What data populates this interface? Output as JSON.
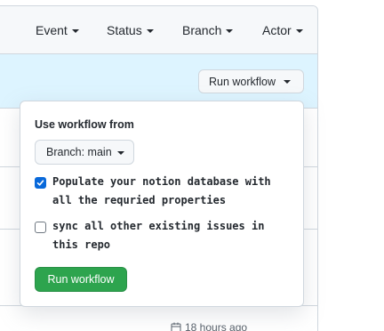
{
  "filters": [
    {
      "label": "Event"
    },
    {
      "label": "Status"
    },
    {
      "label": "Branch"
    },
    {
      "label": "Actor"
    }
  ],
  "run_button_label": "Run workflow",
  "popover": {
    "title": "Use workflow from",
    "branch_label": "Branch: main",
    "inputs": [
      {
        "label": "Populate your notion database with all the requried properties",
        "checked": true
      },
      {
        "label": "sync all other existing issues in this repo",
        "checked": false
      }
    ],
    "submit_label": "Run workflow"
  },
  "timestamp": "18 hours ago",
  "colors": {
    "accent": "#0969da",
    "success": "#2da44e",
    "highlight": "#ddf4ff"
  }
}
